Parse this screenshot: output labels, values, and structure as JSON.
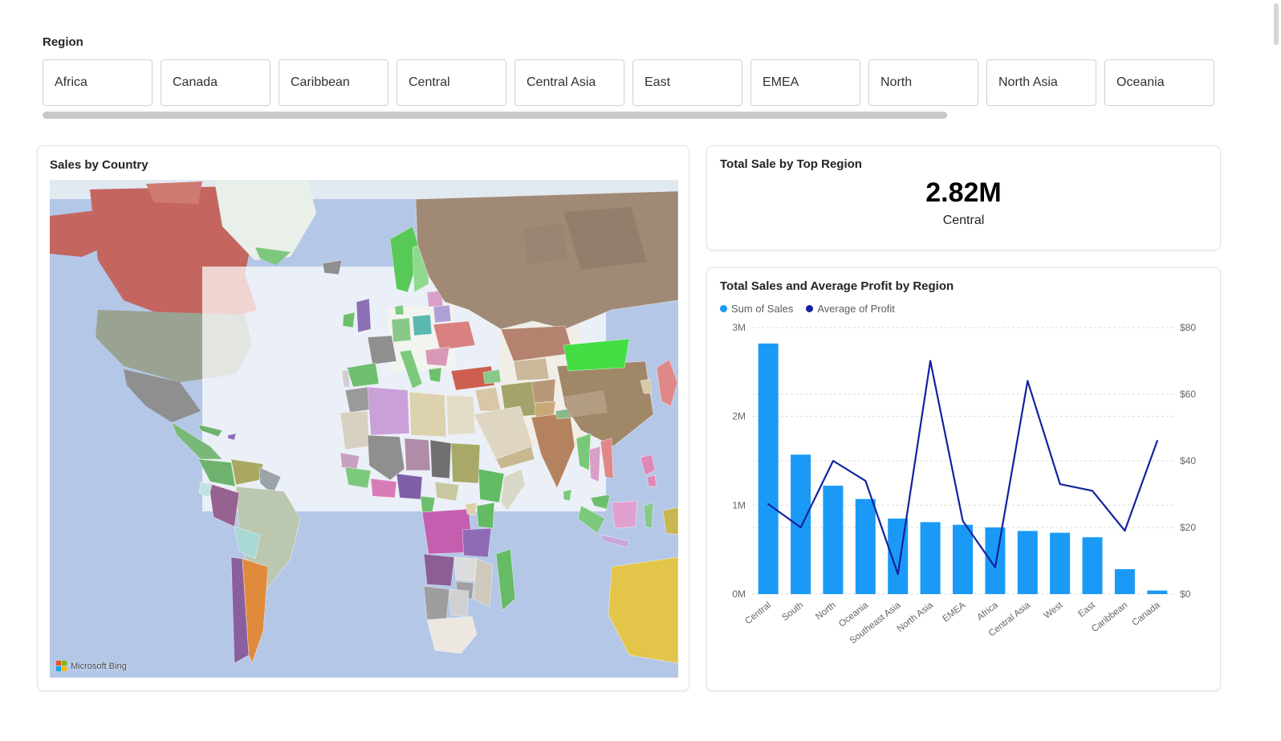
{
  "filters": {
    "label": "Region",
    "options": [
      "Africa",
      "Canada",
      "Caribbean",
      "Central",
      "Central Asia",
      "East",
      "EMEA",
      "North",
      "North Asia",
      "Oceania"
    ]
  },
  "map_card": {
    "title": "Sales by Country",
    "attribution": "Microsoft Bing"
  },
  "kpi_card": {
    "title": "Total Sale by Top Region",
    "value": "2.82M",
    "region": "Central"
  },
  "chart_card": {
    "title": "Total Sales and Average Profit by Region",
    "legend": [
      {
        "label": "Sum of Sales",
        "color": "#1A9AF6"
      },
      {
        "label": "Average of Profit",
        "color": "#12239E"
      }
    ]
  },
  "chart_data": {
    "type": "bar",
    "subtype": "combo-bar-line",
    "title": "Total Sales and Average Profit by Region",
    "categories": [
      "Central",
      "South",
      "North",
      "Oceania",
      "Southeast Asia",
      "North Asia",
      "EMEA",
      "Africa",
      "Central Asia",
      "West",
      "East",
      "Caribbean",
      "Canada"
    ],
    "series": [
      {
        "name": "Sum of Sales",
        "type": "bar",
        "axis": "left",
        "color": "#1A9AF6",
        "unit": "M",
        "values": [
          2.82,
          1.57,
          1.22,
          1.07,
          0.85,
          0.81,
          0.78,
          0.75,
          0.71,
          0.69,
          0.64,
          0.28,
          0.04
        ]
      },
      {
        "name": "Average of Profit",
        "type": "line",
        "axis": "right",
        "color": "#12239E",
        "unit": "$",
        "values": [
          27,
          20,
          40,
          34,
          6,
          70,
          22,
          8,
          64,
          33,
          31,
          19,
          46
        ]
      }
    ],
    "left_axis": {
      "min": 0,
      "max": 3,
      "ticks": [
        {
          "value": 0,
          "label": "0M"
        },
        {
          "value": 1,
          "label": "1M"
        },
        {
          "value": 2,
          "label": "2M"
        },
        {
          "value": 3,
          "label": "3M"
        }
      ]
    },
    "right_axis": {
      "min": 0,
      "max": 80,
      "ticks": [
        {
          "value": 0,
          "label": "$0"
        },
        {
          "value": 20,
          "label": "$20"
        },
        {
          "value": 40,
          "label": "$40"
        },
        {
          "value": 60,
          "label": "$60"
        },
        {
          "value": 80,
          "label": "$80"
        }
      ]
    },
    "grid": "dashed-horizontal",
    "legend_position": "top-left",
    "x_label_rotation": -38
  }
}
